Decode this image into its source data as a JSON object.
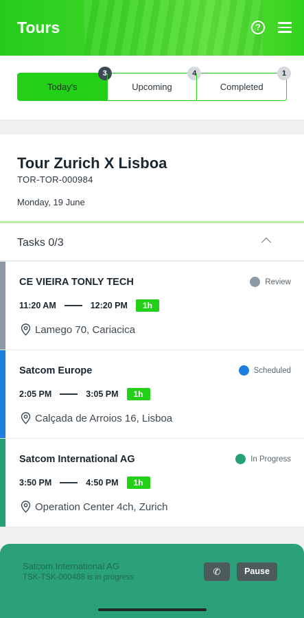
{
  "header": {
    "title": "Tours",
    "help_icon": "help-circle-icon",
    "menu_icon": "hamburger-menu-icon"
  },
  "tabs": [
    {
      "label": "Today's",
      "count": "3",
      "active": true
    },
    {
      "label": "Upcoming",
      "count": "4",
      "active": false
    },
    {
      "label": "Completed",
      "count": "1",
      "active": false
    }
  ],
  "tour": {
    "name": "Tour Zurich X Lisboa",
    "code": "TOR-TOR-000984",
    "date": "Monday, 19 June"
  },
  "tasks_header": {
    "label": "Tasks 0/3"
  },
  "tasks": [
    {
      "name": "CE VIEIRA TONLY TECH",
      "status": "Review",
      "status_color": "#8d9aa5",
      "bar_color": "#8d9aa5",
      "start": "11:20 AM",
      "end": "12:20 PM",
      "duration": "1h",
      "address": "Lamego 70, Cariacica"
    },
    {
      "name": "Satcom Europe",
      "status": "Scheduled",
      "status_color": "#1e7fe0",
      "bar_color": "#1e7fe0",
      "start": "2:05 PM",
      "end": "3:05 PM",
      "duration": "1h",
      "address": "Calçada de Arroios 16, Lisboa"
    },
    {
      "name": "Satcom International AG",
      "status": "In Progress",
      "status_color": "#22a07a",
      "bar_color": "#22a07a",
      "start": "3:50 PM",
      "end": "4:50 PM",
      "duration": "1h",
      "address": "Operation Center 4ch, Zurich"
    }
  ],
  "bottom_bar": {
    "company": "Satcom International AG",
    "progress_text": "TSK-TSK-000488 is in progress",
    "call_icon": "phone-icon",
    "pause_label": "Pause"
  },
  "colors": {
    "brand_green": "#22d017",
    "footer_teal": "#2aa17a"
  }
}
